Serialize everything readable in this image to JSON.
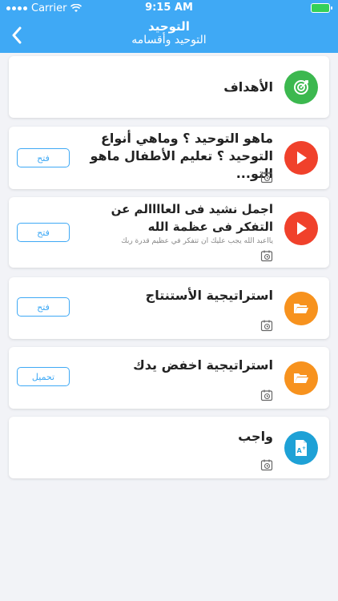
{
  "statusbar": {
    "carrier": "Carrier",
    "time": "9:15 AM"
  },
  "header": {
    "title": "التوحيد",
    "subtitle": "التوحيد وأقسامه"
  },
  "items": [
    {
      "title": "الأهداف",
      "icon": "target-icon",
      "color": "#3cb84f"
    },
    {
      "title": "ماهو التوحيد ؟ وماهي أنواع التوحيد ؟ تعليم الأطفال ماهو التو...",
      "icon": "play-icon",
      "color": "#f0412b",
      "button": "فتح"
    },
    {
      "title": "اجمل نشيد فى العاااالم عن التفكر فى عظمة الله",
      "description": "يااعبد الله يجب عليك ان تتفكر في عظيم قدرة ربك",
      "icon": "play-icon",
      "color": "#f0412b",
      "button": "فتح"
    },
    {
      "title": "استراتيجية الأستنتاج",
      "icon": "folder-icon",
      "color": "#f7921e",
      "button": "فتح"
    },
    {
      "title": "استراتيجية اخفض يدك",
      "icon": "folder-icon",
      "color": "#f7921e",
      "button": "تحميل"
    },
    {
      "title": "واجب",
      "icon": "assignment-doc-icon",
      "color": "#1ea1d6"
    }
  ]
}
